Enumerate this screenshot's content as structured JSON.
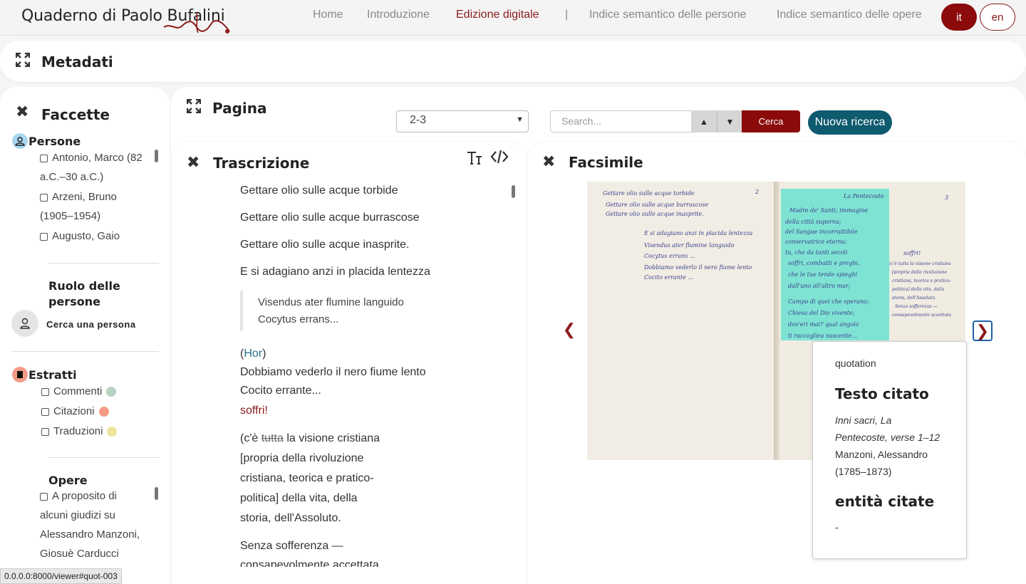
{
  "header": {
    "logo": "Quaderno di Paolo Bufalini",
    "nav": [
      "Home",
      "Introduzione",
      "Edizione digitale",
      "|",
      "Indice semantico delle persone",
      "Indice semantico delle opere"
    ],
    "lang_it": "it",
    "lang_en": "en",
    "accent": "#8b0a0a"
  },
  "metadati": {
    "title": "Metadati"
  },
  "facets": {
    "title": "Faccette",
    "persone_label": "Persone",
    "persone": [
      {
        "l1": "Antonio, Marco (82",
        "l2": "a.C.–30 a.C.)"
      },
      {
        "l1": "Arzeni, Bruno",
        "l2": "(1905–1954)"
      },
      {
        "l1": "Augusto, Gaio",
        "l2": ""
      }
    ],
    "ruolo_l1": "Ruolo delle",
    "ruolo_l2": "persone",
    "cerca_persona": "Cerca una persona",
    "estratti_label": "Estratti",
    "estratti": [
      {
        "label": "Commenti",
        "color": "#b7d3c2"
      },
      {
        "label": "Citazioni",
        "color": "#f39b86"
      },
      {
        "label": "Traduzioni",
        "color": "#eee49a"
      }
    ],
    "opere_label": "Opere",
    "opere": [
      "A proposito di",
      "alcuni giudizi su",
      "Alessandro Manzoni,",
      "Giosuè Carducci"
    ]
  },
  "pagina": {
    "title": "Pagina",
    "selected_page": "2-3",
    "search_placeholder": "Search...",
    "cerca_label": "Cerca",
    "nuova_ricerca_label": "Nuova ricerca"
  },
  "trascrizione": {
    "title": "Trascrizione",
    "lines": [
      "Gettare olio sulle acque torbide",
      "Gettare olio sulle acque burrascose",
      "Gettare olio sulle acque inasprite.",
      "E si adagiano anzi in placida lentezza"
    ],
    "quote_l1": "Visendus ater flumine languido",
    "quote_l2": "Cocytus errans...",
    "hor_open": "(",
    "hor": "Hor",
    "hor_close": ")",
    "dobb_l1": "Dobbiamo vederlo il nero fiume lento",
    "dobb_l2": "Cocito errante...",
    "soffri": "soffri!",
    "p1_open": "(c'è ",
    "p1_del": "tutta",
    "p1_rest": " la visione cristiana",
    "p2": "[propria della rivoluzione",
    "p3": "cristiana, teorica e pratico-",
    "p4": "politica] della vita, della",
    "p5": "storia, dell'Assoluto.",
    "s1": "Senza sofferenza —",
    "s2": "consapevolmente accettata"
  },
  "facsimile": {
    "title": "Facsimile",
    "highlight_color": "#7fe3d4",
    "left_page_lines": [
      "Gettare olio sulle acque torbide",
      "Gettare olio sulle acque burrascose",
      "Gettare olio sulle acque inasprite.",
      "E si adagiano anzi in placida lentezza",
      "Visendus ater flumine languido",
      "Cocytus errans ...",
      "Dobbiamo vederlo il nero fiume lento",
      "Cocito errante ..."
    ],
    "right_heading": "La Pentecoste",
    "right_page_lines": [
      "Madre de' Santi; immagine",
      "della città superna;",
      "del Sangue incorruttibile",
      "conservatrice eterna;",
      "tu, che da tanti secoli",
      "soffri, combatti e preghi,",
      "che le tue tende spieghi",
      "dall'uno all'altro mar;",
      "Campo di quei che sperano;",
      "Chiesa del Dio vivente;",
      "dov'eri mai? qual angolo",
      "ti raccogliea nascente..."
    ],
    "margin_lines": [
      "soffri!",
      "(c'è tutta la visione cristiana",
      "[propria della rivoluzione",
      "cristiana, teorica e pratico-",
      "politica] della vita, della",
      "storia, dell'Assoluto.",
      "Senza sofferenza —",
      "consapevolmente accettata"
    ],
    "page_numbers": [
      "2",
      "3"
    ]
  },
  "tooltip": {
    "type": "quotation",
    "heading": "Testo citato",
    "work_l1": "Inni sacri, La",
    "work_l2": "Pentecoste, verse 1–12",
    "author_l1": "Manzoni, Alessandro",
    "author_l2": "(1785–1873)",
    "entita": "entità citate",
    "entita_value": "-"
  },
  "status_url": "0.0.0.0:8000/viewer#quot-003"
}
